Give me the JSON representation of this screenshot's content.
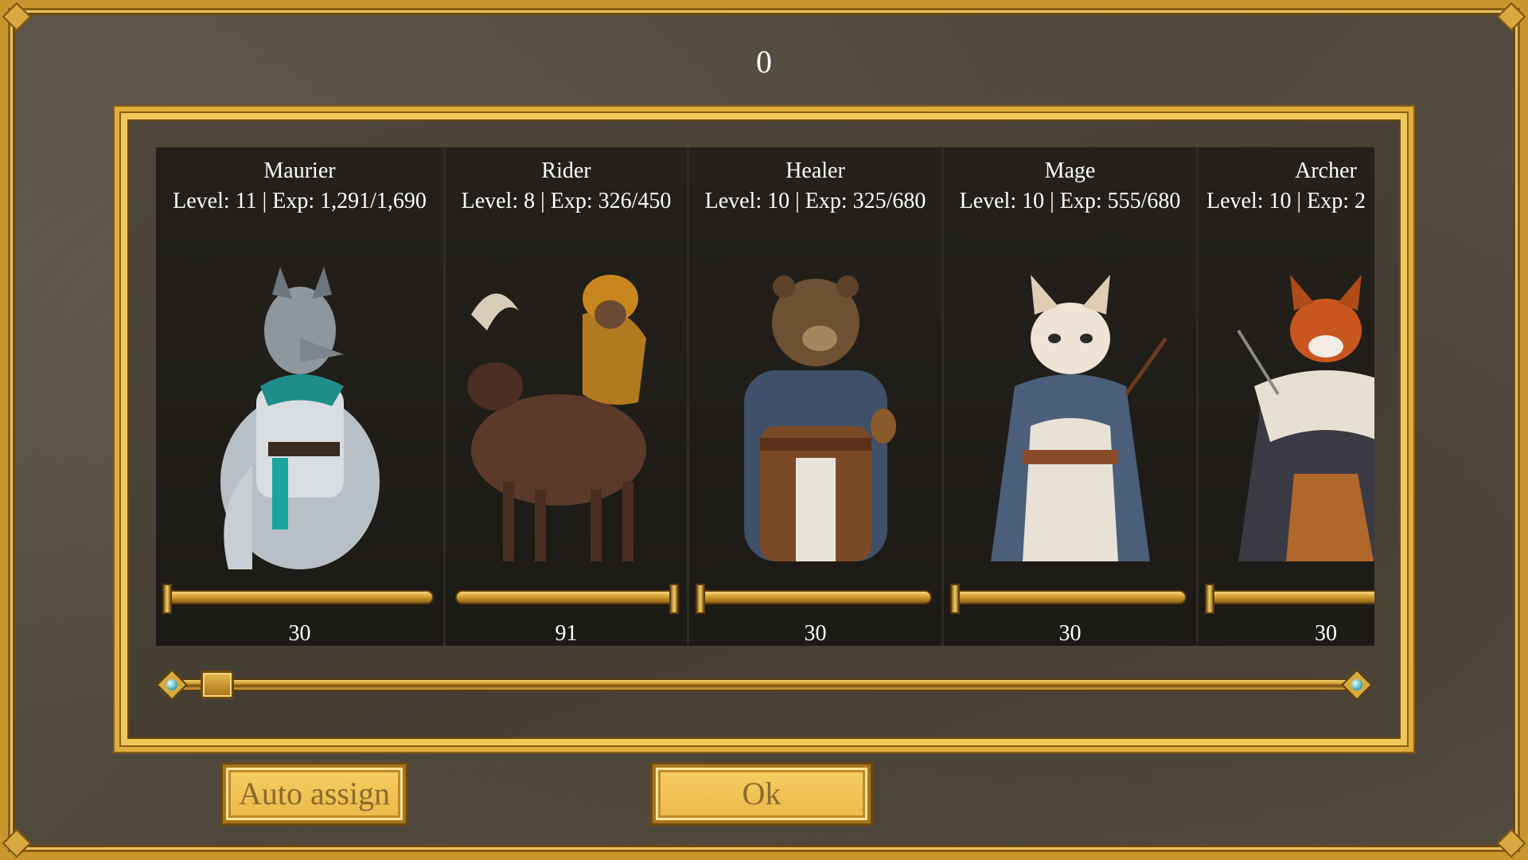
{
  "header": {
    "value": "0"
  },
  "cards": [
    {
      "name": "Maurier",
      "stats": "Level: 11 | Exp: 1,291/1,690",
      "value": "30",
      "icon": "wolf-knight-portrait",
      "slider_fraction": 0.0
    },
    {
      "name": "Rider",
      "stats": "Level: 8 | Exp: 326/450",
      "value": "91",
      "icon": "monkey-moose-rider-portrait",
      "slider_fraction": 1.0
    },
    {
      "name": "Healer",
      "stats": "Level: 10 | Exp: 325/680",
      "value": "30",
      "icon": "bear-healer-portrait",
      "slider_fraction": 0.0
    },
    {
      "name": "Mage",
      "stats": "Level: 10 | Exp: 555/680",
      "value": "30",
      "icon": "cat-mage-portrait",
      "slider_fraction": 0.0
    },
    {
      "name": "Archer",
      "stats": "Level: 10 | Exp: 2",
      "value": "30",
      "icon": "fox-archer-portrait",
      "slider_fraction": 0.0
    }
  ],
  "scroll": {
    "position_fraction": 0.0
  },
  "buttons": {
    "auto_assign": "Auto assign",
    "ok": "Ok"
  },
  "colors": {
    "gold": "#e0ae3c",
    "panel": "#1e1b17",
    "button_text": "#8b6a2c"
  }
}
